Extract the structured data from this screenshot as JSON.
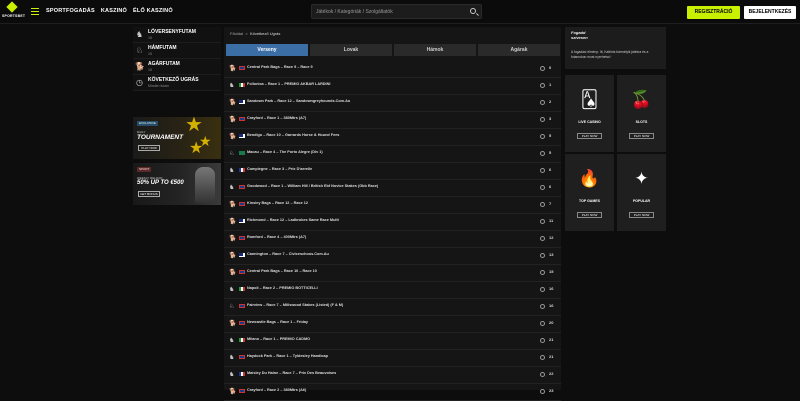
{
  "brand": {
    "logo_text": "SPORTSBET",
    "accent": "#c8f000"
  },
  "nav": {
    "items": [
      "SPORTFOGADÁS",
      "KASZINÓ",
      "ÉLŐ KASZINÓ"
    ]
  },
  "search": {
    "placeholder": "Játékok / Kategóriák / Szolgáltatók"
  },
  "auth": {
    "register_label": "REGISZTRÁCIÓ",
    "login_label": "BEJELENTKEZÉS"
  },
  "sidebar": {
    "items": [
      {
        "title": "LÓVERSENYFUTAM",
        "sub": "15",
        "icon": "horse-icon"
      },
      {
        "title": "HÁMFUTAM",
        "sub": "15",
        "icon": "harness-icon"
      },
      {
        "title": "AGÁRFUTAM",
        "sub": "15",
        "icon": "greyhound-icon"
      },
      {
        "title": "KÖVETKEZŐ UGRÁS",
        "sub": "Minden futam",
        "icon": "clock-icon"
      }
    ]
  },
  "banners": [
    {
      "badge": "EXCLUSIVE",
      "small": "DAILY",
      "big": "TOURNAMENT",
      "button": "PLAY NOW"
    },
    {
      "badge": "SPORT",
      "small": "WEEKLY RELOAD",
      "big": "50% UP TO €500",
      "button": "GET BONUS"
    }
  ],
  "main": {
    "breadcrumb_home": "Főoldal",
    "breadcrumb_sep": ">",
    "breadcrumb_current": "Következő Ugrás",
    "tabs": [
      "Verseny",
      "Lovak",
      "Hámok",
      "Agárak"
    ],
    "races": [
      {
        "icon": "greyhound-icon",
        "flag": "uk",
        "title": "Central Park Bags – Race 9 – Race 9",
        "num": "0"
      },
      {
        "icon": "horse-icon",
        "flag": "it",
        "title": "Follonica – Race 1 – PREMIO AKBAR LARDINI",
        "num": "1"
      },
      {
        "icon": "greyhound-icon",
        "flag": "au",
        "title": "Sandown Park – Race 12 – Sandowngreyhounds.Com.Au",
        "num": "2"
      },
      {
        "icon": "greyhound-icon",
        "flag": "uk",
        "title": "Crayford – Race 1 – 380Mtrs (A7)",
        "num": "3"
      },
      {
        "icon": "greyhound-icon",
        "flag": "au",
        "title": "Bendigo – Race 10 – Garrards Horse & Hound Fees",
        "num": "5"
      },
      {
        "icon": "harness-icon",
        "flag": "mo",
        "title": "Macau – Race 4 – The Porto Alegre (Div 1)",
        "num": "5"
      },
      {
        "icon": "horse-icon",
        "flag": "fr",
        "title": "Compiegne – Race 3 – Prix D'aerelle",
        "num": "6"
      },
      {
        "icon": "horse-icon",
        "flag": "uk",
        "title": "Goodwood – Race 1 – William Hill / British Ebf Novice Stakes (Gbb Race)",
        "num": "6"
      },
      {
        "icon": "greyhound-icon",
        "flag": "uk",
        "title": "Kinsley Bags – Race 12 – Race 12",
        "num": "7"
      },
      {
        "icon": "greyhound-icon",
        "flag": "au",
        "title": "Richmond – Race 12 – Ladbrokes Same Race Multi",
        "num": "11"
      },
      {
        "icon": "greyhound-icon",
        "flag": "uk",
        "title": "Romford – Race 4 – 400Mtrs (A7)",
        "num": "12"
      },
      {
        "icon": "greyhound-icon",
        "flag": "au",
        "title": "Cannington – Race 7 – Civiceschoos.Com.Au",
        "num": "13"
      },
      {
        "icon": "greyhound-icon",
        "flag": "uk",
        "title": "Central Park Bags – Race 10 – Race 10",
        "num": "15"
      },
      {
        "icon": "horse-icon",
        "flag": "it",
        "title": "Napoli – Race 2 – PREMIO BOTTICELLI",
        "num": "16"
      },
      {
        "icon": "harness-icon",
        "flag": "uk",
        "title": "Fairview – Race 7 – Millswood Stakes (Listed) (F & M)",
        "num": "16"
      },
      {
        "icon": "greyhound-icon",
        "flag": "uk",
        "title": "Newcastle Bags – Race 1 – Friday",
        "num": "20"
      },
      {
        "icon": "horse-icon",
        "flag": "it",
        "title": "Milano – Race 1 – PREMIO CADMO",
        "num": "21"
      },
      {
        "icon": "horse-icon",
        "flag": "uk",
        "title": "Haydock Park – Race 1 – Tyldesley Handicap",
        "num": "21"
      },
      {
        "icon": "horse-icon",
        "flag": "fr",
        "title": "Maisley Du Haine – Race 7 – Prix Des Beauvoises",
        "num": "22"
      },
      {
        "icon": "greyhound-icon",
        "flag": "uk",
        "title": "Crayford – Race 2 – 380Mtrs (A6)",
        "num": "23"
      }
    ]
  },
  "right": {
    "promo_title": "Fogadd szívesen",
    "promo_text": "A fogadási élmény: Itt, Kattints bármelyik játékra és a futamokon most nyerhetsz!",
    "cards": [
      {
        "label": "LIVE CASINO",
        "icon": "playing-cards-icon",
        "glyph": "🂡",
        "button": "PLAY NOW"
      },
      {
        "label": "SLOTS",
        "icon": "cherries-icon",
        "glyph": "🍒",
        "button": "PLAY NOW"
      },
      {
        "label": "TOP GAMES",
        "icon": "flame-icon",
        "glyph": "🔥",
        "button": "PLAY NOW"
      },
      {
        "label": "POPULAR",
        "icon": "sparkle-icon",
        "glyph": "✦",
        "button": "PLAY NOW"
      }
    ]
  }
}
